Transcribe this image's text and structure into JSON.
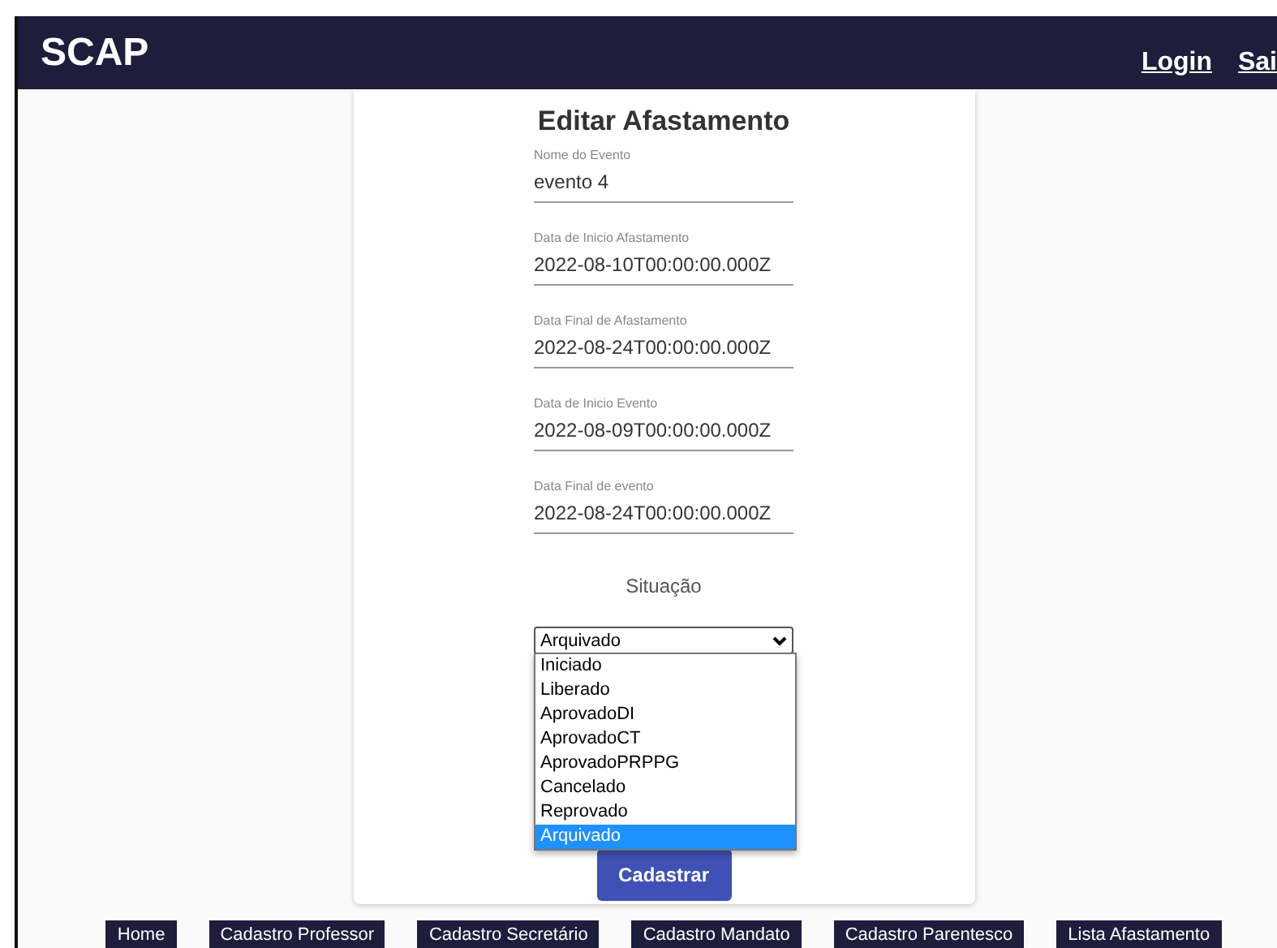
{
  "header": {
    "logo": "SCAP",
    "links": [
      "Login",
      "Sai"
    ]
  },
  "form": {
    "title": "Editar Afastamento",
    "fields": [
      {
        "label": "Nome do Evento",
        "value": "evento 4"
      },
      {
        "label": "Data de Inicio Afastamento",
        "value": "2022-08-10T00:00:00.000Z"
      },
      {
        "label": "Data Final de Afastamento",
        "value": "2022-08-24T00:00:00.000Z"
      },
      {
        "label": "Data de Inicio Evento",
        "value": "2022-08-09T00:00:00.000Z"
      },
      {
        "label": "Data Final de evento",
        "value": "2022-08-24T00:00:00.000Z"
      }
    ],
    "situacao": {
      "label": "Situação",
      "value": "Arquivado",
      "expanded": true,
      "options": [
        {
          "label": "Iniciado",
          "selected": false
        },
        {
          "label": "Liberado",
          "selected": false
        },
        {
          "label": "AprovadoDI",
          "selected": false
        },
        {
          "label": "AprovadoCT",
          "selected": false
        },
        {
          "label": "AprovadoPRPPG",
          "selected": false
        },
        {
          "label": "Cancelado",
          "selected": false
        },
        {
          "label": "Reprovado",
          "selected": false
        },
        {
          "label": "Arquivado",
          "selected": true
        }
      ]
    },
    "submit": "Cadastrar"
  },
  "nav": [
    "Home",
    "Cadastro Professor",
    "Cadastro Secretário",
    "Cadastro Mandato",
    "Cadastro Parentesco",
    "Lista Afastamento"
  ]
}
